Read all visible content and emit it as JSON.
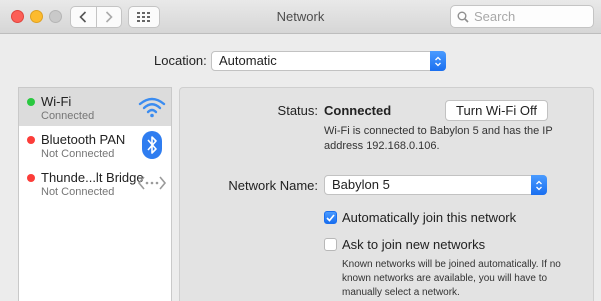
{
  "window": {
    "title": "Network"
  },
  "search": {
    "placeholder": "Search"
  },
  "location": {
    "label": "Location:",
    "value": "Automatic"
  },
  "services": [
    {
      "name": "Wi-Fi",
      "status": "Connected",
      "dot_color": "#2ac840",
      "icon": "wifi-icon"
    },
    {
      "name": "Bluetooth PAN",
      "status": "Not Connected",
      "dot_color": "#fc3d39",
      "icon": "bluetooth-icon"
    },
    {
      "name": "Thunde...lt Bridge",
      "status": "Not Connected",
      "dot_color": "#fc3d39",
      "icon": "thunderbolt-bridge-icon"
    }
  ],
  "detail": {
    "status_label": "Status:",
    "status_value": "Connected",
    "turn_off_label": "Turn Wi-Fi Off",
    "status_description": "Wi-Fi is connected to Babylon 5 and has the IP address 192.168.0.106.",
    "network_name_label": "Network Name:",
    "network_name_value": "Babylon 5",
    "auto_join_label": "Automatically join this network",
    "auto_join_checked": true,
    "ask_join_label": "Ask to join new networks",
    "ask_join_checked": false,
    "ask_join_note": "Known networks will be joined automatically. If no known networks are available, you will have to manually select a network."
  },
  "colors": {
    "accent": "#1a6ff0",
    "selected_row": "#dcdcdc"
  }
}
